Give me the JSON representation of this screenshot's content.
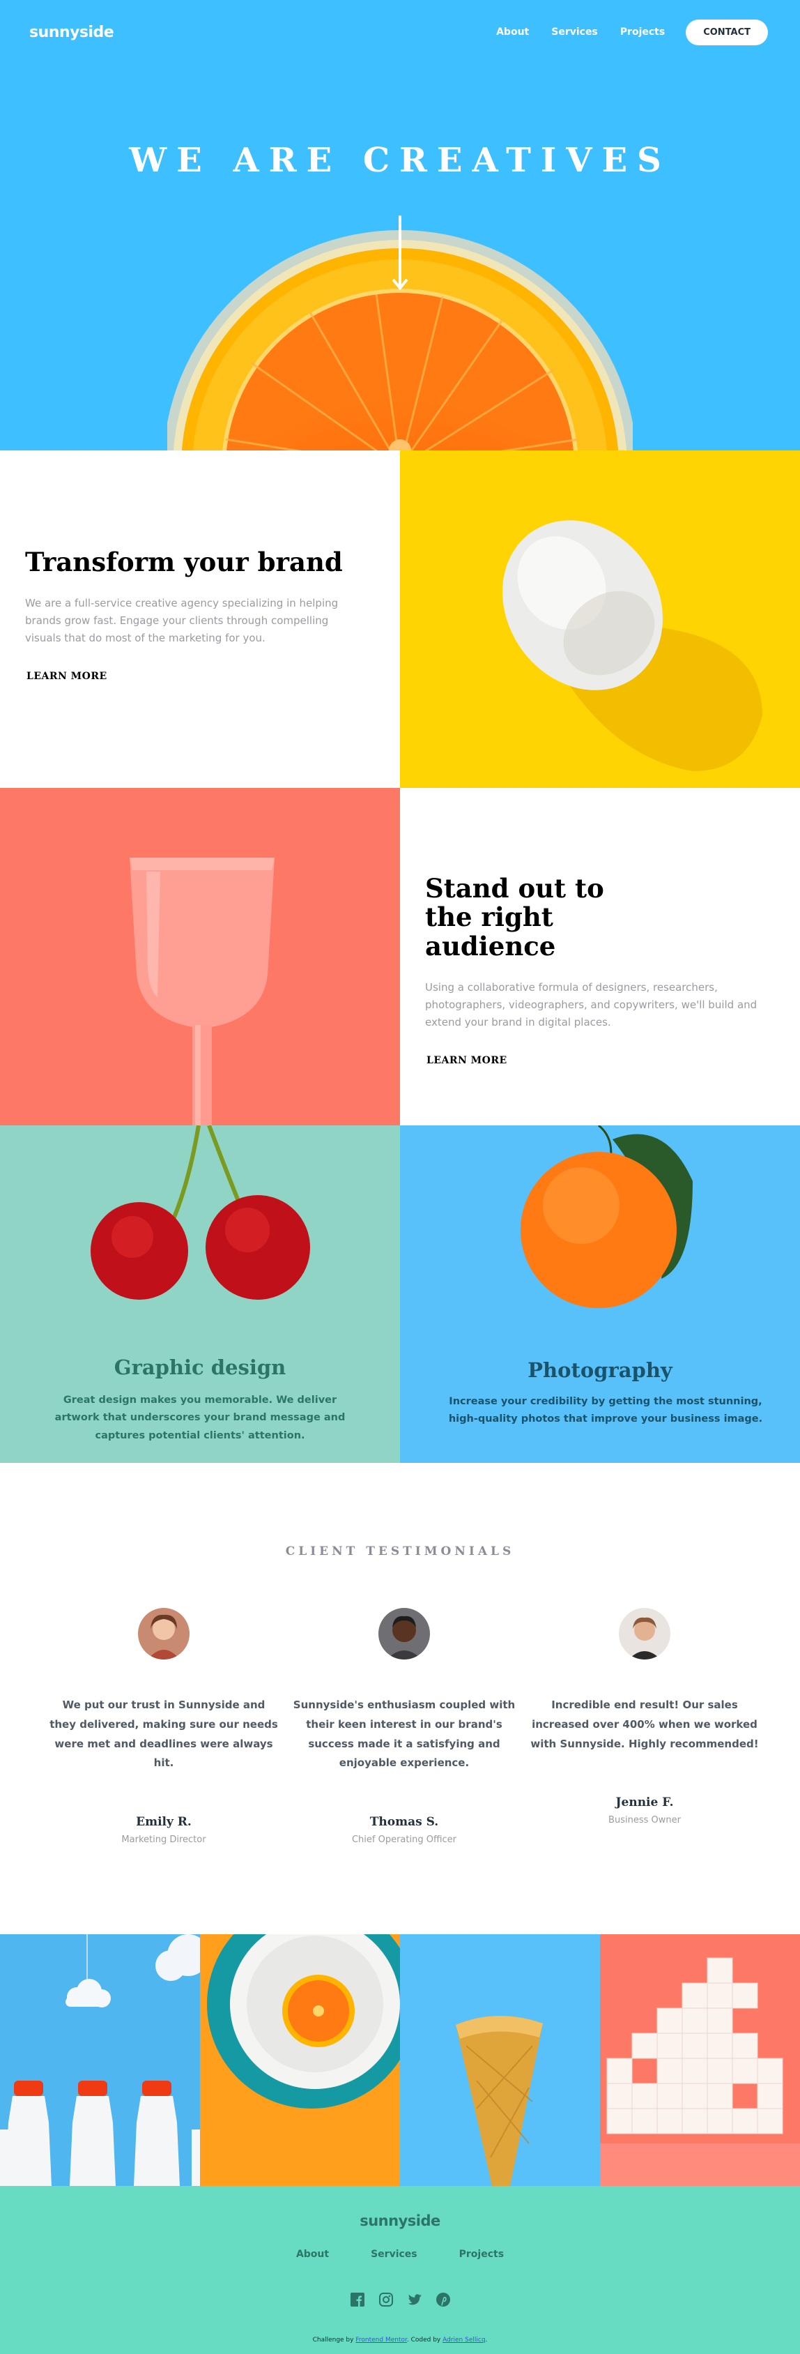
{
  "nav": {
    "logo": "sunnyside",
    "links": [
      "About",
      "Services",
      "Projects"
    ],
    "contact": "CONTACT"
  },
  "hero": {
    "title": "WE ARE CREATIVES"
  },
  "features": [
    {
      "title": "Transform your brand",
      "text": "We are a full-service creative agency specializing in helping brands grow fast. Engage your clients through compelling visuals that do most of the marketing for you.",
      "link": "LEARN MORE",
      "underline_color": "#fbd400"
    },
    {
      "title": "Stand out to the right audience",
      "text": "Using a collaborative formula of designers, researchers, photographers, videographers, and copywriters, we'll build and extend your brand in digital places.",
      "link": "LEARN MORE",
      "underline_color": "#fe7866"
    }
  ],
  "services": [
    {
      "title": "Graphic design",
      "text": "Great design makes you memorable. We deliver artwork that underscores your brand message and captures potential clients' attention.",
      "color": "#2c7566"
    },
    {
      "title": "Photography",
      "text": "Increase your credibility by getting the most stunning, high-quality photos that improve your business image.",
      "color": "#19536b"
    }
  ],
  "testimonials": {
    "heading": "CLIENT TESTIMONIALS",
    "items": [
      {
        "quote": "We put our trust in Sunnyside and they delivered, making sure our needs were met and deadlines were always hit.",
        "name": "Emily R.",
        "role": "Marketing Director"
      },
      {
        "quote": "Sunnyside's enthusiasm coupled with their keen interest in our brand's success made it a satisfying and enjoyable experience.",
        "name": "Thomas S.",
        "role": "Chief Operating Officer"
      },
      {
        "quote": "Incredible end result! Our sales increased over 400% when we worked with Sunnyside. Highly recommended!",
        "name": "Jennie F.",
        "role": "Business Owner"
      }
    ]
  },
  "footer": {
    "logo": "sunnyside",
    "links": [
      "About",
      "Services",
      "Projects"
    ],
    "social_icons": [
      "facebook-icon",
      "instagram-icon",
      "twitter-icon",
      "pinterest-icon"
    ],
    "attr_prefix": "Challenge by",
    "attr_fm": "Frontend Mentor",
    "attr_mid": ". Coded by",
    "attr_author": "Adrien Sellicq",
    "attr_end": "."
  },
  "colors": {
    "hero_bg": "#3ebfff",
    "egg_bg": "#ffd402",
    "glass_bg": "#fe7866",
    "design_bg": "#90d4c5",
    "photo_bg": "#58c1f9",
    "footer_bg": "#68dcc3"
  }
}
